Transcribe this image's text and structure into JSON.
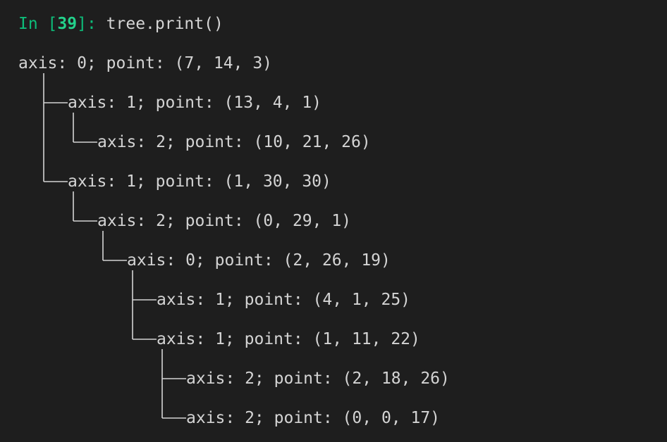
{
  "prompt": {
    "in_label": "In [",
    "number": "39",
    "close_label": "]:",
    "command": "tree.print()"
  },
  "nodes": [
    {
      "text": "axis: 0; point: (7, 14, 3)"
    },
    {
      "text": "axis: 1; point: (13, 4, 1)"
    },
    {
      "text": "axis: 2; point: (10, 21, 26)"
    },
    {
      "text": "axis: 1; point: (1, 30, 30)"
    },
    {
      "text": "axis: 2; point: (0, 29, 1)"
    },
    {
      "text": "axis: 0; point: (2, 26, 19)"
    },
    {
      "text": "axis: 1; point: (4, 1, 25)"
    },
    {
      "text": "axis: 1; point: (1, 11, 22)"
    },
    {
      "text": "axis: 2; point: (2, 18, 26)"
    },
    {
      "text": "axis: 2; point: (0, 0, 17)"
    }
  ],
  "colors": {
    "background": "#1e1e1e",
    "text": "#d4d4d4",
    "prompt": "#0dbc79",
    "prompt_number": "#23d18b"
  }
}
